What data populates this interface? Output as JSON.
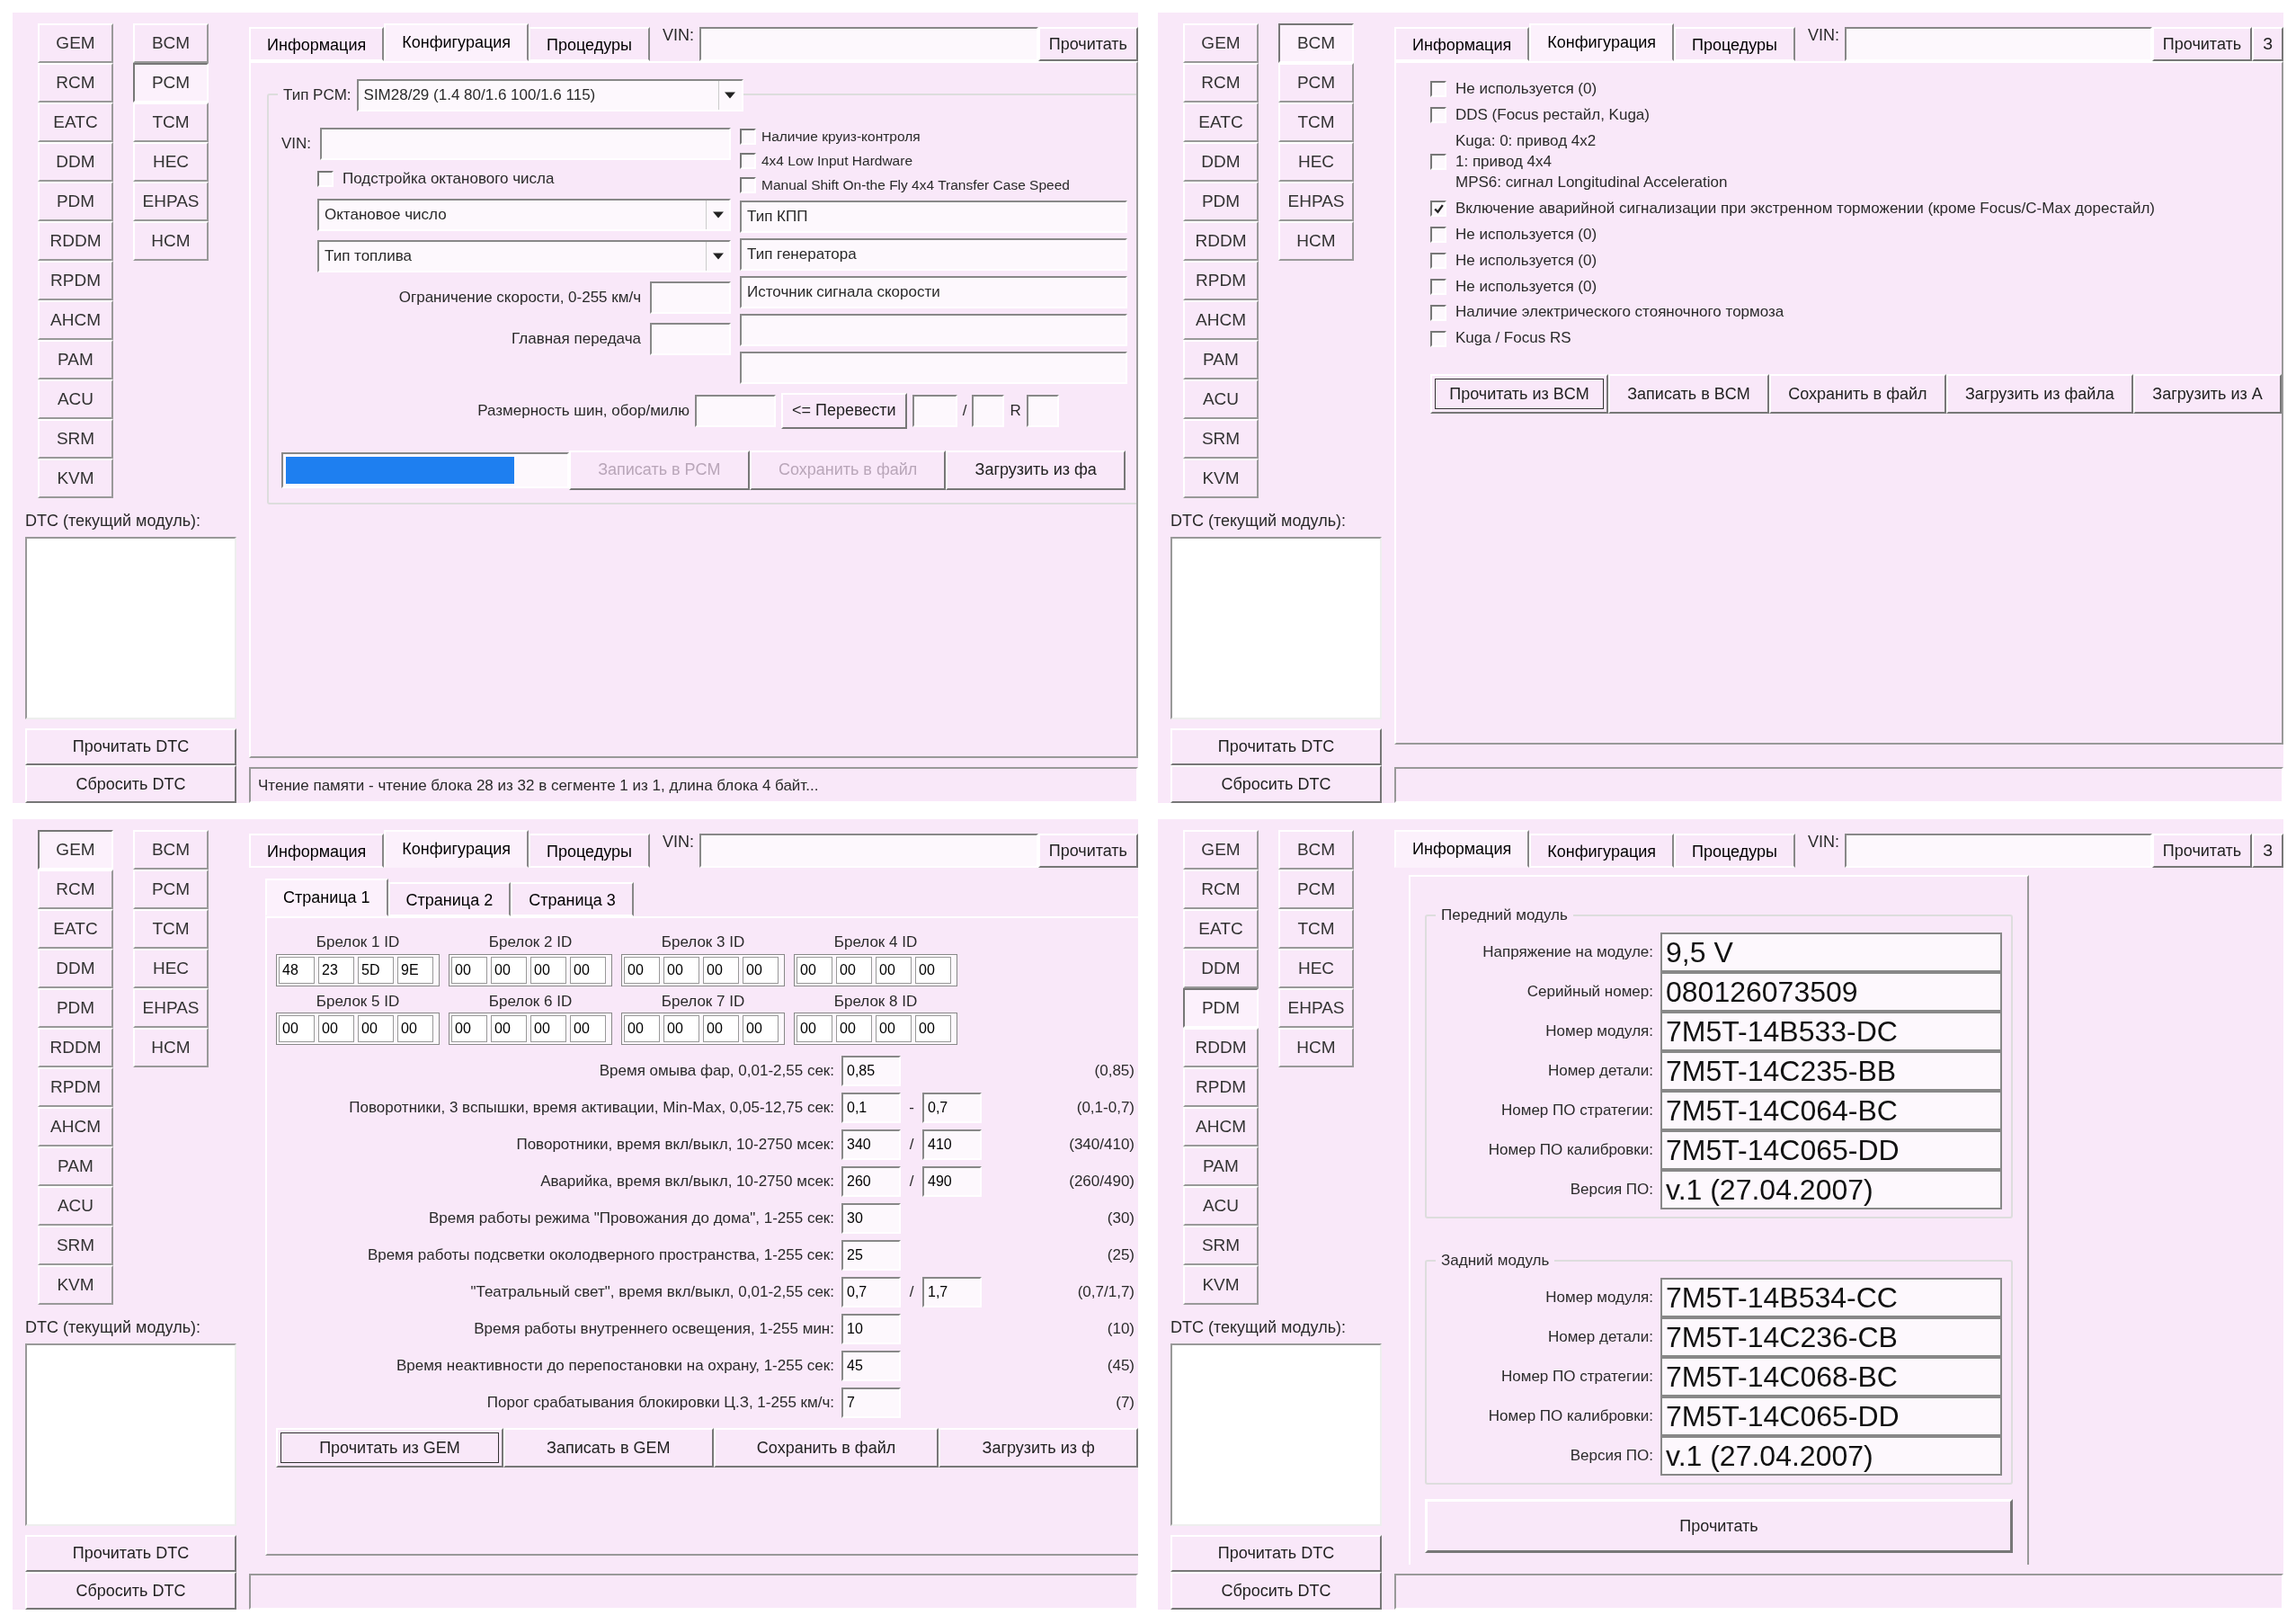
{
  "panels": [
    {
      "kind": "pcm",
      "modules_left": [
        {
          "label": "GEM",
          "selected": false
        },
        {
          "label": "RCM",
          "selected": false
        },
        {
          "label": "EATC",
          "selected": false
        },
        {
          "label": "DDM",
          "selected": false
        },
        {
          "label": "PDM",
          "selected": false
        },
        {
          "label": "RDDM",
          "selected": false
        },
        {
          "label": "RPDM",
          "selected": false
        },
        {
          "label": "AHCM",
          "selected": false
        },
        {
          "label": "PAM",
          "selected": false
        },
        {
          "label": "ACU",
          "selected": false
        },
        {
          "label": "SRM",
          "selected": false
        },
        {
          "label": "KVM",
          "selected": false
        }
      ],
      "modules_right": [
        {
          "label": "BCM",
          "selected": false
        },
        {
          "label": "PCM",
          "selected": true
        },
        {
          "label": "TCM",
          "selected": false
        },
        {
          "label": "HEC",
          "selected": false
        },
        {
          "label": "EHPAS",
          "selected": false
        },
        {
          "label": "HCM",
          "selected": false
        }
      ],
      "dtc_label": "DTC (текущий модуль):",
      "dtc_buttons": [
        "Прочитать DTC",
        "Сбросить DTC"
      ],
      "tabs": [
        {
          "label": "Информация",
          "selected": false
        },
        {
          "label": "Конфигурация",
          "selected": true
        },
        {
          "label": "Процедуры",
          "selected": false
        }
      ],
      "vin_label": "VIN:",
      "read_button": "Прочитать",
      "status": "Чтение памяти - чтение блока 28 из 32 в сегменте 1 из 1, длина блока 4 байт...",
      "content": {
        "type_label": "Тип PCM:",
        "type_value": "SIM28/29 (1.4 80/1.6 100/1.6 115)",
        "vin_label": "VIN:",
        "left_checks": [
          {
            "label": "Подстройка октанового числа",
            "checked": false
          }
        ],
        "combos": [
          "Октановое число",
          "Тип топлива"
        ],
        "fields": [
          {
            "label": "Ограничение скорости, 0-255 км/ч"
          },
          {
            "label": "Главная передача"
          }
        ],
        "right_checks": [
          {
            "label": "Наличие круиз-контроля",
            "checked": false
          },
          {
            "label": "4x4 Low Input Hardware",
            "checked": false
          },
          {
            "label": "Manual Shift On-the Fly 4x4 Transfer Case Speed",
            "checked": false
          }
        ],
        "boxes": [
          {
            "kind": "text",
            "value": "Тип КПП"
          },
          {
            "kind": "text",
            "value": "Тип генератора"
          },
          {
            "kind": "text",
            "value": "Источник сигнала скорости"
          },
          {
            "kind": "empty"
          },
          {
            "kind": "empty"
          }
        ],
        "tire": {
          "label": "Размерность шин, обор/милю",
          "button": "<= Перевести",
          "separator": "/",
          "r_label": "R"
        },
        "progress": {
          "level": 0.82
        },
        "buttons": [
          {
            "label": "Записать в PCM",
            "disabled": true
          },
          {
            "label": "Сохранить в файл",
            "disabled": true
          },
          {
            "label": "Загрузить из фа",
            "disabled": false
          }
        ]
      }
    },
    {
      "kind": "bcm",
      "modules_left": [
        {
          "label": "GEM",
          "selected": false
        },
        {
          "label": "RCM",
          "selected": false
        },
        {
          "label": "EATC",
          "selected": false
        },
        {
          "label": "DDM",
          "selected": false
        },
        {
          "label": "PDM",
          "selected": false
        },
        {
          "label": "RDDM",
          "selected": false
        },
        {
          "label": "RPDM",
          "selected": false
        },
        {
          "label": "AHCM",
          "selected": false
        },
        {
          "label": "PAM",
          "selected": false
        },
        {
          "label": "ACU",
          "selected": false
        },
        {
          "label": "SRM",
          "selected": false
        },
        {
          "label": "KVM",
          "selected": false
        }
      ],
      "modules_right": [
        {
          "label": "BCM",
          "selected": true
        },
        {
          "label": "PCM",
          "selected": false
        },
        {
          "label": "TCM",
          "selected": false
        },
        {
          "label": "HEC",
          "selected": false
        },
        {
          "label": "EHPAS",
          "selected": false
        },
        {
          "label": "HCM",
          "selected": false
        }
      ],
      "dtc_label": "DTC (текущий модуль):",
      "dtc_buttons": [
        "Прочитать DTC",
        "Сбросить DTC"
      ],
      "tabs": [
        {
          "label": "Информация",
          "selected": false
        },
        {
          "label": "Конфигурация",
          "selected": true
        },
        {
          "label": "Процедуры",
          "selected": false
        }
      ],
      "vin_label": "VIN:",
      "read_button": "Прочитать",
      "extra_button": "З",
      "content": {
        "checks": [
          {
            "label": "Не используется (0)",
            "checked": false
          },
          {
            "label": "DDS (Focus рестайл, Kuga)",
            "checked": false
          },
          {
            "lines": [
              "Kuga: 0: привод 4x2",
              "1: привод 4x4",
              "MPS6: сигнал Longitudinal Acceleration"
            ],
            "checked": false
          },
          {
            "label": "Включение аварийной сигнализации при экстренном торможении (кроме Focus/C-Max дорестайл)",
            "checked": true
          },
          {
            "label": "Не используется (0)",
            "checked": false
          },
          {
            "label": "Не используется (0)",
            "checked": false
          },
          {
            "label": "Не используется (0)",
            "checked": false
          },
          {
            "label": "Наличие электрического стояночного тормоза",
            "checked": false
          },
          {
            "label": "Kuga / Focus RS",
            "checked": false
          }
        ],
        "buttons": [
          {
            "label": "Прочитать из BCM",
            "focused": true
          },
          {
            "label": "Записать в BCM",
            "focused": false
          },
          {
            "label": "Сохранить в файл",
            "focused": false
          },
          {
            "label": "Загрузить из файла",
            "focused": false
          },
          {
            "label": "Загрузить из А",
            "focused": false
          }
        ]
      }
    },
    {
      "kind": "gem",
      "modules_left": [
        {
          "label": "GEM",
          "selected": true
        },
        {
          "label": "RCM",
          "selected": false
        },
        {
          "label": "EATC",
          "selected": false
        },
        {
          "label": "DDM",
          "selected": false
        },
        {
          "label": "PDM",
          "selected": false
        },
        {
          "label": "RDDM",
          "selected": false
        },
        {
          "label": "RPDM",
          "selected": false
        },
        {
          "label": "AHCM",
          "selected": false
        },
        {
          "label": "PAM",
          "selected": false
        },
        {
          "label": "ACU",
          "selected": false
        },
        {
          "label": "SRM",
          "selected": false
        },
        {
          "label": "KVM",
          "selected": false
        }
      ],
      "modules_right": [
        {
          "label": "BCM",
          "selected": false
        },
        {
          "label": "PCM",
          "selected": false
        },
        {
          "label": "TCM",
          "selected": false
        },
        {
          "label": "HEC",
          "selected": false
        },
        {
          "label": "EHPAS",
          "selected": false
        },
        {
          "label": "HCM",
          "selected": false
        }
      ],
      "dtc_label": "DTC (текущий модуль):",
      "dtc_buttons": [
        "Прочитать DTC",
        "Сбросить DTC"
      ],
      "tabs": [
        {
          "label": "Информация",
          "selected": false
        },
        {
          "label": "Конфигурация",
          "selected": true
        },
        {
          "label": "Процедуры",
          "selected": false
        }
      ],
      "vin_label": "VIN:",
      "read_button": "Прочитать",
      "content": {
        "pages": [
          {
            "label": "Страница 1",
            "selected": true
          },
          {
            "label": "Страница 2",
            "selected": false
          },
          {
            "label": "Страница 3",
            "selected": false
          }
        ],
        "fobs": [
          {
            "label": "Брелок 1 ID",
            "bytes": [
              "48",
              "23",
              "5D",
              "9E"
            ]
          },
          {
            "label": "Брелок 2 ID",
            "bytes": [
              "00",
              "00",
              "00",
              "00"
            ]
          },
          {
            "label": "Брелок 3 ID",
            "bytes": [
              "00",
              "00",
              "00",
              "00"
            ]
          },
          {
            "label": "Брелок 4 ID",
            "bytes": [
              "00",
              "00",
              "00",
              "00"
            ]
          },
          {
            "label": "Брелок 5 ID",
            "bytes": [
              "00",
              "00",
              "00",
              "00"
            ]
          },
          {
            "label": "Брелок 6 ID",
            "bytes": [
              "00",
              "00",
              "00",
              "00"
            ]
          },
          {
            "label": "Брелок 7 ID",
            "bytes": [
              "00",
              "00",
              "00",
              "00"
            ]
          },
          {
            "label": "Брелок 8 ID",
            "bytes": [
              "00",
              "00",
              "00",
              "00"
            ]
          }
        ],
        "params": [
          {
            "label": "Время омыва фар, 0,01-2,55 сек:",
            "values": [
              "0,85"
            ],
            "default": "(0,85)"
          },
          {
            "label": "Поворотники, 3 вспышки, время активации, Min-Max, 0,05-12,75 сек:",
            "values": [
              "0,1",
              "0,7"
            ],
            "separator": "-",
            "default": "(0,1-0,7)"
          },
          {
            "label": "Поворотники, время вкл/выкл, 10-2750 мсек:",
            "values": [
              "340",
              "410"
            ],
            "separator": "/",
            "default": "(340/410)"
          },
          {
            "label": "Аварийка, время вкл/выкл, 10-2750 мсек:",
            "values": [
              "260",
              "490"
            ],
            "separator": "/",
            "default": "(260/490)"
          },
          {
            "label": "Время работы режима \"Провожания до дома\", 1-255 сек:",
            "values": [
              "30"
            ],
            "default": "(30)"
          },
          {
            "label": "Время работы подсветки околодверного пространства, 1-255 сек:",
            "values": [
              "25"
            ],
            "default": "(25)"
          },
          {
            "label": "\"Театральный свет\", время вкл/выкл, 0,01-2,55 сек:",
            "values": [
              "0,7",
              "1,7"
            ],
            "separator": "/",
            "default": "(0,7/1,7)"
          },
          {
            "label": "Время работы внутреннего освещения, 1-255 мин:",
            "values": [
              "10"
            ],
            "default": "(10)"
          },
          {
            "label": "Время неактивности до перепостановки на охрану, 1-255 сек:",
            "values": [
              "45"
            ],
            "default": "(45)"
          },
          {
            "label": "Порог срабатывания блокировки Ц.З, 1-255 км/ч:",
            "values": [
              "7"
            ],
            "default": "(7)"
          }
        ],
        "buttons": [
          {
            "label": "Прочитать из GEM",
            "focused": true
          },
          {
            "label": "Записать в GEM",
            "focused": false
          },
          {
            "label": "Сохранить в файл",
            "focused": false
          },
          {
            "label": "Загрузить из ф",
            "focused": false
          }
        ]
      }
    },
    {
      "kind": "info",
      "modules_left": [
        {
          "label": "GEM",
          "selected": false
        },
        {
          "label": "RCM",
          "selected": false
        },
        {
          "label": "EATC",
          "selected": false
        },
        {
          "label": "DDM",
          "selected": false
        },
        {
          "label": "PDM",
          "selected": true
        },
        {
          "label": "RDDM",
          "selected": false
        },
        {
          "label": "RPDM",
          "selected": false
        },
        {
          "label": "AHCM",
          "selected": false
        },
        {
          "label": "PAM",
          "selected": false
        },
        {
          "label": "ACU",
          "selected": false
        },
        {
          "label": "SRM",
          "selected": false
        },
        {
          "label": "KVM",
          "selected": false
        }
      ],
      "modules_right": [
        {
          "label": "BCM",
          "selected": false
        },
        {
          "label": "PCM",
          "selected": false
        },
        {
          "label": "TCM",
          "selected": false
        },
        {
          "label": "HEC",
          "selected": false
        },
        {
          "label": "EHPAS",
          "selected": false
        },
        {
          "label": "HCM",
          "selected": false
        }
      ],
      "dtc_label": "DTC (текущий модуль):",
      "dtc_buttons": [
        "Прочитать DTC",
        "Сбросить DTC"
      ],
      "tabs": [
        {
          "label": "Информация",
          "selected": true
        },
        {
          "label": "Конфигурация",
          "selected": false
        },
        {
          "label": "Процедуры",
          "selected": false
        }
      ],
      "vin_label": "VIN:",
      "read_button": "Прочитать",
      "extra_button": "З",
      "content": {
        "groups": [
          {
            "title": "Передний модуль",
            "rows": [
              {
                "label": "Напряжение на модуле:",
                "value": "9,5 V"
              },
              {
                "label": "Серийный номер:",
                "value": "080126073509"
              },
              {
                "label": "Номер модуля:",
                "value": "7M5T-14B533-DC"
              },
              {
                "label": "Номер детали:",
                "value": "7M5T-14C235-BB"
              },
              {
                "label": "Номер ПО стратегии:",
                "value": "7M5T-14C064-BC"
              },
              {
                "label": "Номер ПО калибровки:",
                "value": "7M5T-14C065-DD"
              },
              {
                "label": "Версия ПО:",
                "value": "v.1 (27.04.2007)"
              }
            ]
          },
          {
            "title": "Задний модуль",
            "rows": [
              {
                "label": "Номер модуля:",
                "value": "7M5T-14B534-CC"
              },
              {
                "label": "Номер детали:",
                "value": "7M5T-14C236-CB"
              },
              {
                "label": "Номер ПО стратегии:",
                "value": "7M5T-14C068-BC"
              },
              {
                "label": "Номер ПО калибровки:",
                "value": "7M5T-14C065-DD"
              },
              {
                "label": "Версия ПО:",
                "value": "v.1 (27.04.2007)"
              }
            ]
          }
        ],
        "button": "Прочитать"
      }
    }
  ]
}
